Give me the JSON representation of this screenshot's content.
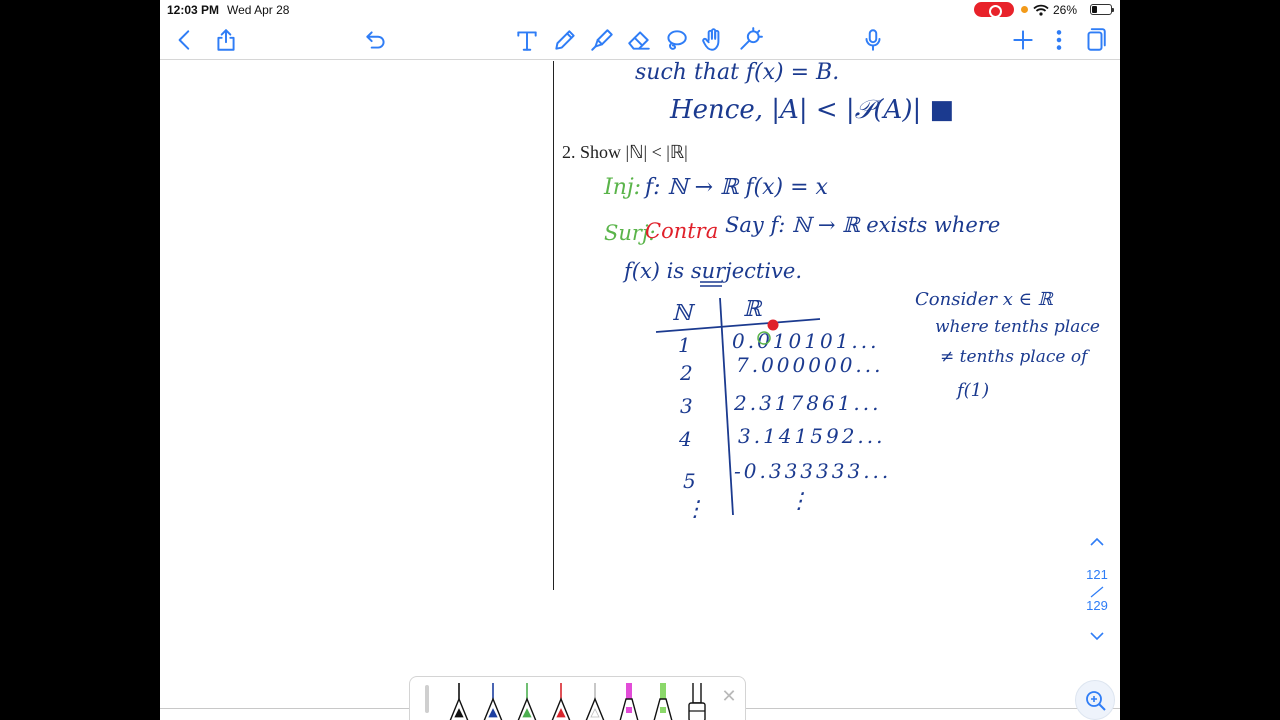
{
  "status_bar": {
    "time": "12:03 PM",
    "date": "Wed Apr 28",
    "battery": "26%"
  },
  "toolbar": {
    "left": [
      "back-icon",
      "share-icon",
      "undo-icon"
    ],
    "tools": [
      "text-tool-icon",
      "pen-tool-icon",
      "highlighter-tool-icon",
      "eraser-tool-icon",
      "lasso-tool-icon",
      "hand-tool-icon",
      "laser-pointer-icon"
    ],
    "right": [
      "microphone-icon",
      "add-page-icon",
      "more-icon",
      "pages-icon"
    ],
    "accent_color": "#2f7df6"
  },
  "note": {
    "top_text_line1": "such that f(x) = B.",
    "top_text_line2": "Hence, |A| < |𝒫(A)| ■",
    "heading": "2.   Show |ℕ| < |ℝ|",
    "inj_label": "Inj:",
    "inj_text": "f: ℕ → ℝ   f(x) = x",
    "surj_label": "Surj:",
    "contra_label": "Contra",
    "surj_text": "Say f: ℕ → ℝ exists where",
    "surj_text2": "f(x) is surjective.",
    "table_header_left": "ℕ",
    "table_header_right": "ℝ",
    "table_rows": [
      {
        "n": "1",
        "r": "0.010101..."
      },
      {
        "n": "2",
        "r": "7.000000..."
      },
      {
        "n": "3",
        "r": "2.317861..."
      },
      {
        "n": "4",
        "r": "3.141592..."
      },
      {
        "n": "5",
        "r": "-0.333333..."
      }
    ],
    "table_left_ellipsis": "⋮",
    "table_right_ellipsis": "⋮",
    "consider_line1": "Consider x ∈ ℝ",
    "consider_line2": "where tenths place",
    "consider_line3": "≠ tenths place of",
    "consider_line4": "f(1)",
    "ink_colors": {
      "blue": "#1b3a8f",
      "green": "#5ab44a",
      "red": "#e0202a"
    }
  },
  "page_nav": {
    "current": "121",
    "total": "129"
  },
  "pen_tray": {
    "pens": [
      {
        "name": "black",
        "color": "#111111"
      },
      {
        "name": "blue",
        "color": "#1d3fa0"
      },
      {
        "name": "green",
        "color": "#4caf50"
      },
      {
        "name": "red",
        "color": "#d8252d"
      },
      {
        "name": "white",
        "color": "#ffffff"
      },
      {
        "name": "pink-highlighter",
        "color": "#e24cd8"
      },
      {
        "name": "green-highlighter",
        "color": "#8bd86a"
      },
      {
        "name": "eraser",
        "color": "#ffffff"
      }
    ]
  }
}
